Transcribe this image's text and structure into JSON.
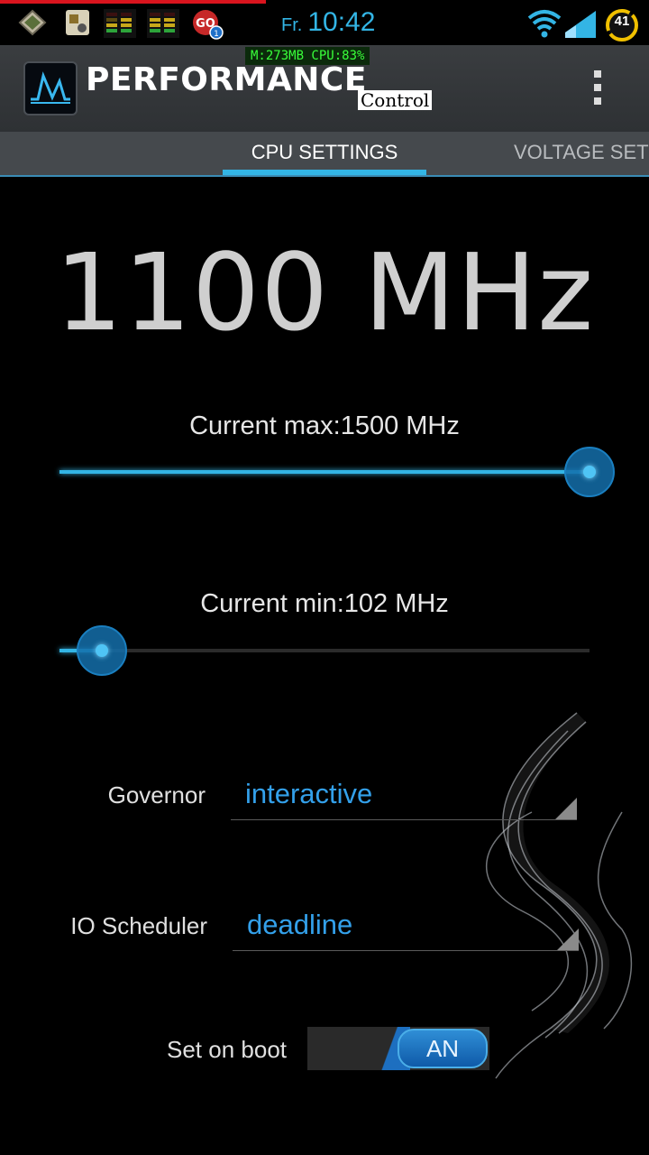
{
  "status_bar": {
    "day": "Fr.",
    "time": "10:42",
    "battery_level": "41",
    "icons": [
      "photo-frame-icon",
      "app-icon",
      "equalizer-widget-icon",
      "equalizer-widget-icon",
      "go-sms-icon",
      "wifi-icon",
      "signal-icon",
      "battery-icon"
    ]
  },
  "overlay": {
    "text": "M:273MB  CPU:83%"
  },
  "action_bar": {
    "title": "PERFORMANCE",
    "subtitle": "Control",
    "menu_icon": "overflow-menu-icon"
  },
  "tabs": [
    {
      "label": "CPU SETTINGS",
      "active": true
    },
    {
      "label": "VOLTAGE SETTINGS",
      "active": false
    }
  ],
  "cpu": {
    "current_frequency": "1100 MHz",
    "max_label": "Current max:1500 MHz",
    "max_slider_fraction": 1.0,
    "min_label": "Current min:102 MHz",
    "min_slider_fraction": 0.08,
    "governor_label": "Governor",
    "governor_value": "interactive",
    "io_scheduler_label": "IO Scheduler",
    "io_scheduler_value": "deadline",
    "set_on_boot_label": "Set on boot",
    "set_on_boot_state": "AN"
  },
  "colors": {
    "accent": "#33b5e5",
    "spinner_text": "#33a0ea",
    "overlay_text": "#39ff3a"
  }
}
